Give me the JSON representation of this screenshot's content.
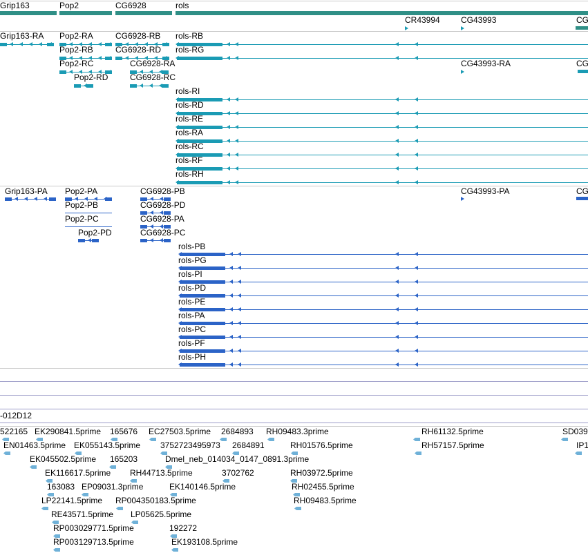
{
  "colors": {
    "gene": "#2f8f86",
    "transcript_RA": "#1a9bb4",
    "transcript_PA": "#2b63c7",
    "est": "#6fb1d8",
    "separator": "#9c9cc8"
  },
  "genes": [
    {
      "name": "Grip163",
      "label": "Grip163"
    },
    {
      "name": "Pop2",
      "label": "Pop2"
    },
    {
      "name": "CG6928",
      "label": "CG6928"
    },
    {
      "name": "rols",
      "label": "rols"
    },
    {
      "name": "CR43994",
      "label": "CR43994"
    },
    {
      "name": "CG43993",
      "label": "CG43993"
    },
    {
      "name": "cg-cut",
      "label": "CG"
    }
  ],
  "transcripts": [
    {
      "label": "Grip163-RA"
    },
    {
      "label": "Pop2-RA"
    },
    {
      "label": "CG6928-RB"
    },
    {
      "label": "rols-RB"
    },
    {
      "label": "Pop2-RB"
    },
    {
      "label": "CG6928-RD"
    },
    {
      "label": "rols-RG"
    },
    {
      "label": "Pop2-RC"
    },
    {
      "label": "CG6928-RA"
    },
    {
      "label": "CG43993-RA"
    },
    {
      "label": "CG"
    },
    {
      "label": "Pop2-RD"
    },
    {
      "label": "CG6928-RC"
    },
    {
      "label": "rols-RI"
    },
    {
      "label": "rols-RD"
    },
    {
      "label": "rols-RE"
    },
    {
      "label": "rols-RA"
    },
    {
      "label": "rols-RC"
    },
    {
      "label": "rols-RF"
    },
    {
      "label": "rols-RH"
    }
  ],
  "proteins": [
    {
      "label": "Grip163-PA"
    },
    {
      "label": "Pop2-PA"
    },
    {
      "label": "CG6928-PB"
    },
    {
      "label": "CG43993-PA"
    },
    {
      "label": "CG"
    },
    {
      "label": "Pop2-PB"
    },
    {
      "label": "CG6928-PD"
    },
    {
      "label": "Pop2-PC"
    },
    {
      "label": "CG6928-PA"
    },
    {
      "label": "Pop2-PD"
    },
    {
      "label": "CG6928-PC"
    },
    {
      "label": "rols-PB"
    },
    {
      "label": "rols-PG"
    },
    {
      "label": "rols-PI"
    },
    {
      "label": "rols-PD"
    },
    {
      "label": "rols-PE"
    },
    {
      "label": "rols-PA"
    },
    {
      "label": "rols-PC"
    },
    {
      "label": "rols-PF"
    },
    {
      "label": "rols-PH"
    }
  ],
  "clone_label": "-012D12",
  "ests": [
    {
      "label": "522165"
    },
    {
      "label": "EK290841.5prime"
    },
    {
      "label": "165676"
    },
    {
      "label": "EC27503.5prime"
    },
    {
      "label": "2684893"
    },
    {
      "label": "RH09483.3prime"
    },
    {
      "label": "RH61132.5prime"
    },
    {
      "label": "SD039"
    },
    {
      "label": "EN01463.5prime"
    },
    {
      "label": "EK055143.5prime"
    },
    {
      "label": "3752723495973"
    },
    {
      "label": "2684891"
    },
    {
      "label": "RH01576.5prime"
    },
    {
      "label": "RH57157.5prime"
    },
    {
      "label": "IP1"
    },
    {
      "label": "EK045502.5prime"
    },
    {
      "label": "165203"
    },
    {
      "label": "Dmel_neb_014034_0147_0891.3prime"
    },
    {
      "label": "EK116617.5prime"
    },
    {
      "label": "RH44713.5prime"
    },
    {
      "label": "3702762"
    },
    {
      "label": "RH03972.5prime"
    },
    {
      "label": "163083"
    },
    {
      "label": "EP09031.3prime"
    },
    {
      "label": "EK140146.5prime"
    },
    {
      "label": "RH02455.5prime"
    },
    {
      "label": "LP22141.5prime"
    },
    {
      "label": "RP004350183.5prime"
    },
    {
      "label": "RH09483.5prime"
    },
    {
      "label": "RE43571.5prime"
    },
    {
      "label": "LP05625.5prime"
    },
    {
      "label": "RP003029771.5prime"
    },
    {
      "label": "192272"
    },
    {
      "label": "RP003129713.5prime"
    },
    {
      "label": "EK193108.5prime"
    }
  ]
}
